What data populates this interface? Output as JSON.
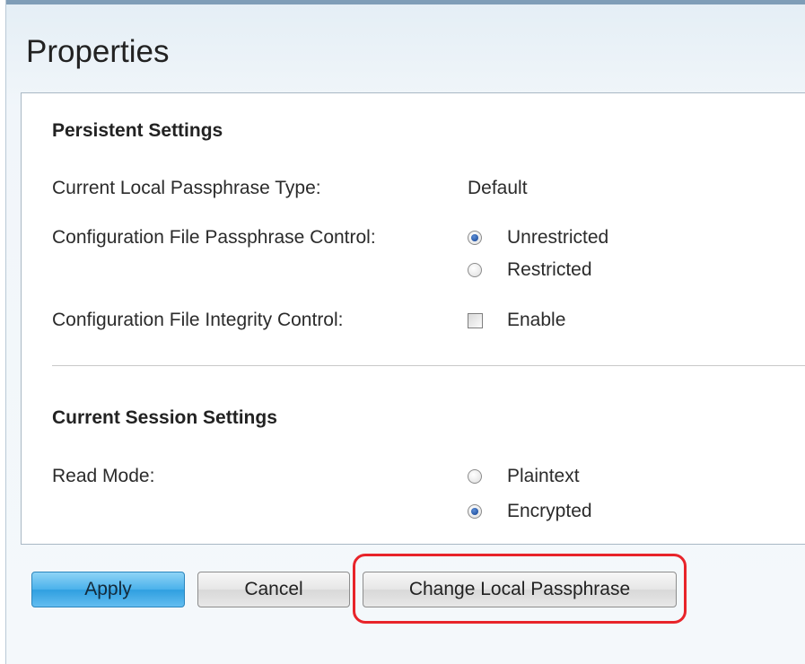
{
  "page": {
    "title": "Properties"
  },
  "persistent": {
    "title": "Persistent Settings",
    "passphrase_type": {
      "label": "Current Local Passphrase Type:",
      "value": "Default"
    },
    "passphrase_control": {
      "label": "Configuration File Passphrase Control:",
      "options": [
        {
          "label": "Unrestricted",
          "checked": true
        },
        {
          "label": "Restricted",
          "checked": false
        }
      ]
    },
    "integrity_control": {
      "label": "Configuration File Integrity Control:",
      "checkbox_label": "Enable",
      "checked": false
    }
  },
  "session": {
    "title": "Current Session Settings",
    "read_mode": {
      "label": "Read Mode:",
      "options": [
        {
          "label": "Plaintext",
          "checked": false
        },
        {
          "label": "Encrypted",
          "checked": true
        }
      ]
    }
  },
  "buttons": {
    "apply": "Apply",
    "cancel": "Cancel",
    "change_passphrase": "Change Local Passphrase"
  },
  "colors": {
    "apply_button": "#4ab1eb",
    "highlight_ring": "#e8242a",
    "background": "#f1f6fa"
  }
}
